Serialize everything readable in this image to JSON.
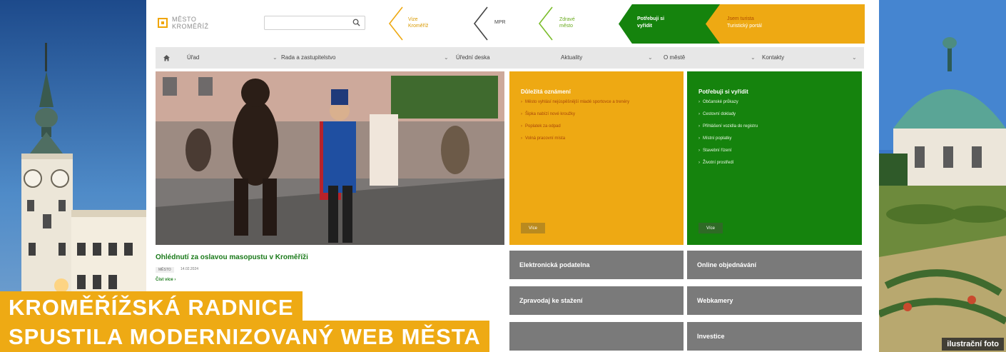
{
  "brand": {
    "line1": "MĚSTO",
    "line2": "KROMĚŘÍŽ"
  },
  "search": {
    "placeholder": ""
  },
  "quick_links": [
    {
      "label_1": "Vize",
      "label_2": "Kroměříž"
    },
    {
      "label_1": "MPR",
      "label_2": ""
    },
    {
      "label_1": "Zdravé",
      "label_2": "město"
    }
  ],
  "tabs": {
    "green_1": "Potřebuji si",
    "green_2": "vyřídit",
    "orange_1": "Jsem turista",
    "orange_2": "Turistický portál"
  },
  "nav": {
    "items": [
      "Úřad",
      "Rada a zastupitelstvo",
      "Úřední deska",
      "Aktuality",
      "O městě",
      "Kontakty"
    ]
  },
  "news": {
    "title": "Ohlédnutí za oslavou masopustu v Kroměříži",
    "tag": "MĚSTO",
    "date": "14.02.2024",
    "more": "Číst více"
  },
  "announcements": {
    "title": "Důležitá oznámení",
    "items": [
      "Město vyhlásí nejúspěšnější mladé sportovce a trenéry",
      "Šipka nabízí nové kroužky",
      "Poplatek za odpad",
      "Volná pracovní místa"
    ],
    "button": "Více"
  },
  "services": {
    "title": "Potřebuji si vyřídit",
    "items": [
      "Občanské průkazy",
      "Cestovní doklady",
      "Přihlášení vozidla do registru",
      "Místní poplatky",
      "Stavební řízení",
      "Životní prostředí"
    ],
    "button": "Více"
  },
  "tiles": {
    "podatelna": "Elektronická podatelna",
    "objednavani": "Online objednávání",
    "zpravodaj": "Zpravodaj ke stažení",
    "webkamery": "Webkamery",
    "investice": "Investice"
  },
  "caption": {
    "line1": "KROMĚŘÍŽSKÁ RADNICE",
    "line2": "SPUSTILA MODERNIZOVANÝ WEB MĚSTA",
    "photo_note": "ilustrační foto"
  },
  "colors": {
    "accent": "#eeaa14",
    "green": "#15830d",
    "tile_gray": "#7a7a7a"
  }
}
